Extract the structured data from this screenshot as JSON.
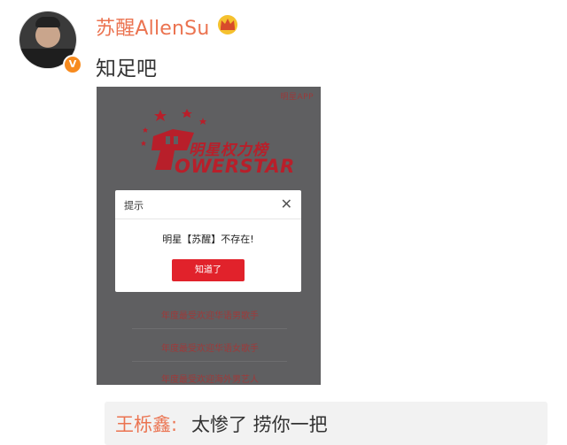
{
  "post": {
    "author": "苏醒AllenSu",
    "verified_badge": "V",
    "crown_icon": "crown-icon",
    "text": "知足吧"
  },
  "screenshot": {
    "tag": "明星APP",
    "logo_cn": "明星权力榜",
    "logo_en": "OWERSTAR",
    "bg_rows": [
      "年度最受欢迎华语男歌手",
      "年度最受欢迎华语女歌手",
      "年度最受欢迎海外男艺人"
    ],
    "dialog": {
      "title": "提示",
      "close": "✕",
      "message": "明星【苏醒】不存在!",
      "button": "知道了"
    }
  },
  "comment": {
    "author": "王栎鑫:",
    "text": "太惨了 捞你一把"
  },
  "colors": {
    "name": "#eb7350",
    "accent_red": "#e1222b"
  }
}
